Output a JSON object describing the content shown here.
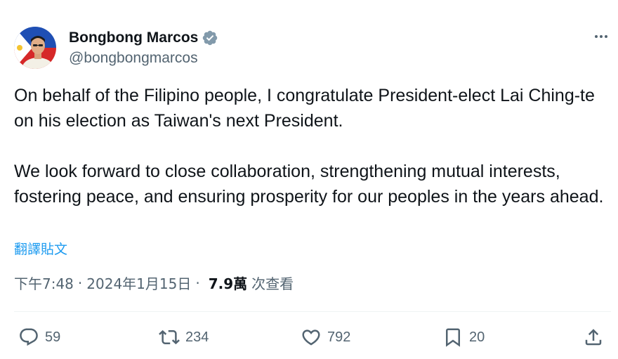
{
  "author": {
    "display_name": "Bongbong Marcos",
    "handle": "@bongbongmarcos",
    "verified": true,
    "verified_color": "#829aab"
  },
  "tweet": {
    "paragraphs": [
      "On behalf of the Filipino people, I congratulate President-elect Lai Ching-te on his election as Taiwan's next President.",
      "We look forward to close collaboration, strengthening mutual interests, fostering peace, and ensuring prosperity for our peoples in the years ahead."
    ],
    "translate_label": "翻譯貼文"
  },
  "meta": {
    "time": "下午7:48",
    "separator": "·",
    "date": "2024年1月15日",
    "views_count": "7.9萬",
    "views_label": "次查看"
  },
  "actions": {
    "replies": "59",
    "reposts": "234",
    "likes": "792",
    "bookmarks": "20"
  },
  "icons": {
    "more": "more-horizontal-icon",
    "reply": "reply-icon",
    "repost": "repost-icon",
    "like": "heart-icon",
    "bookmark": "bookmark-icon",
    "share": "share-icon"
  },
  "colors": {
    "text": "#0f1419",
    "secondary": "#536471",
    "link": "#1d9bf0",
    "divider": "#eff3f4"
  }
}
